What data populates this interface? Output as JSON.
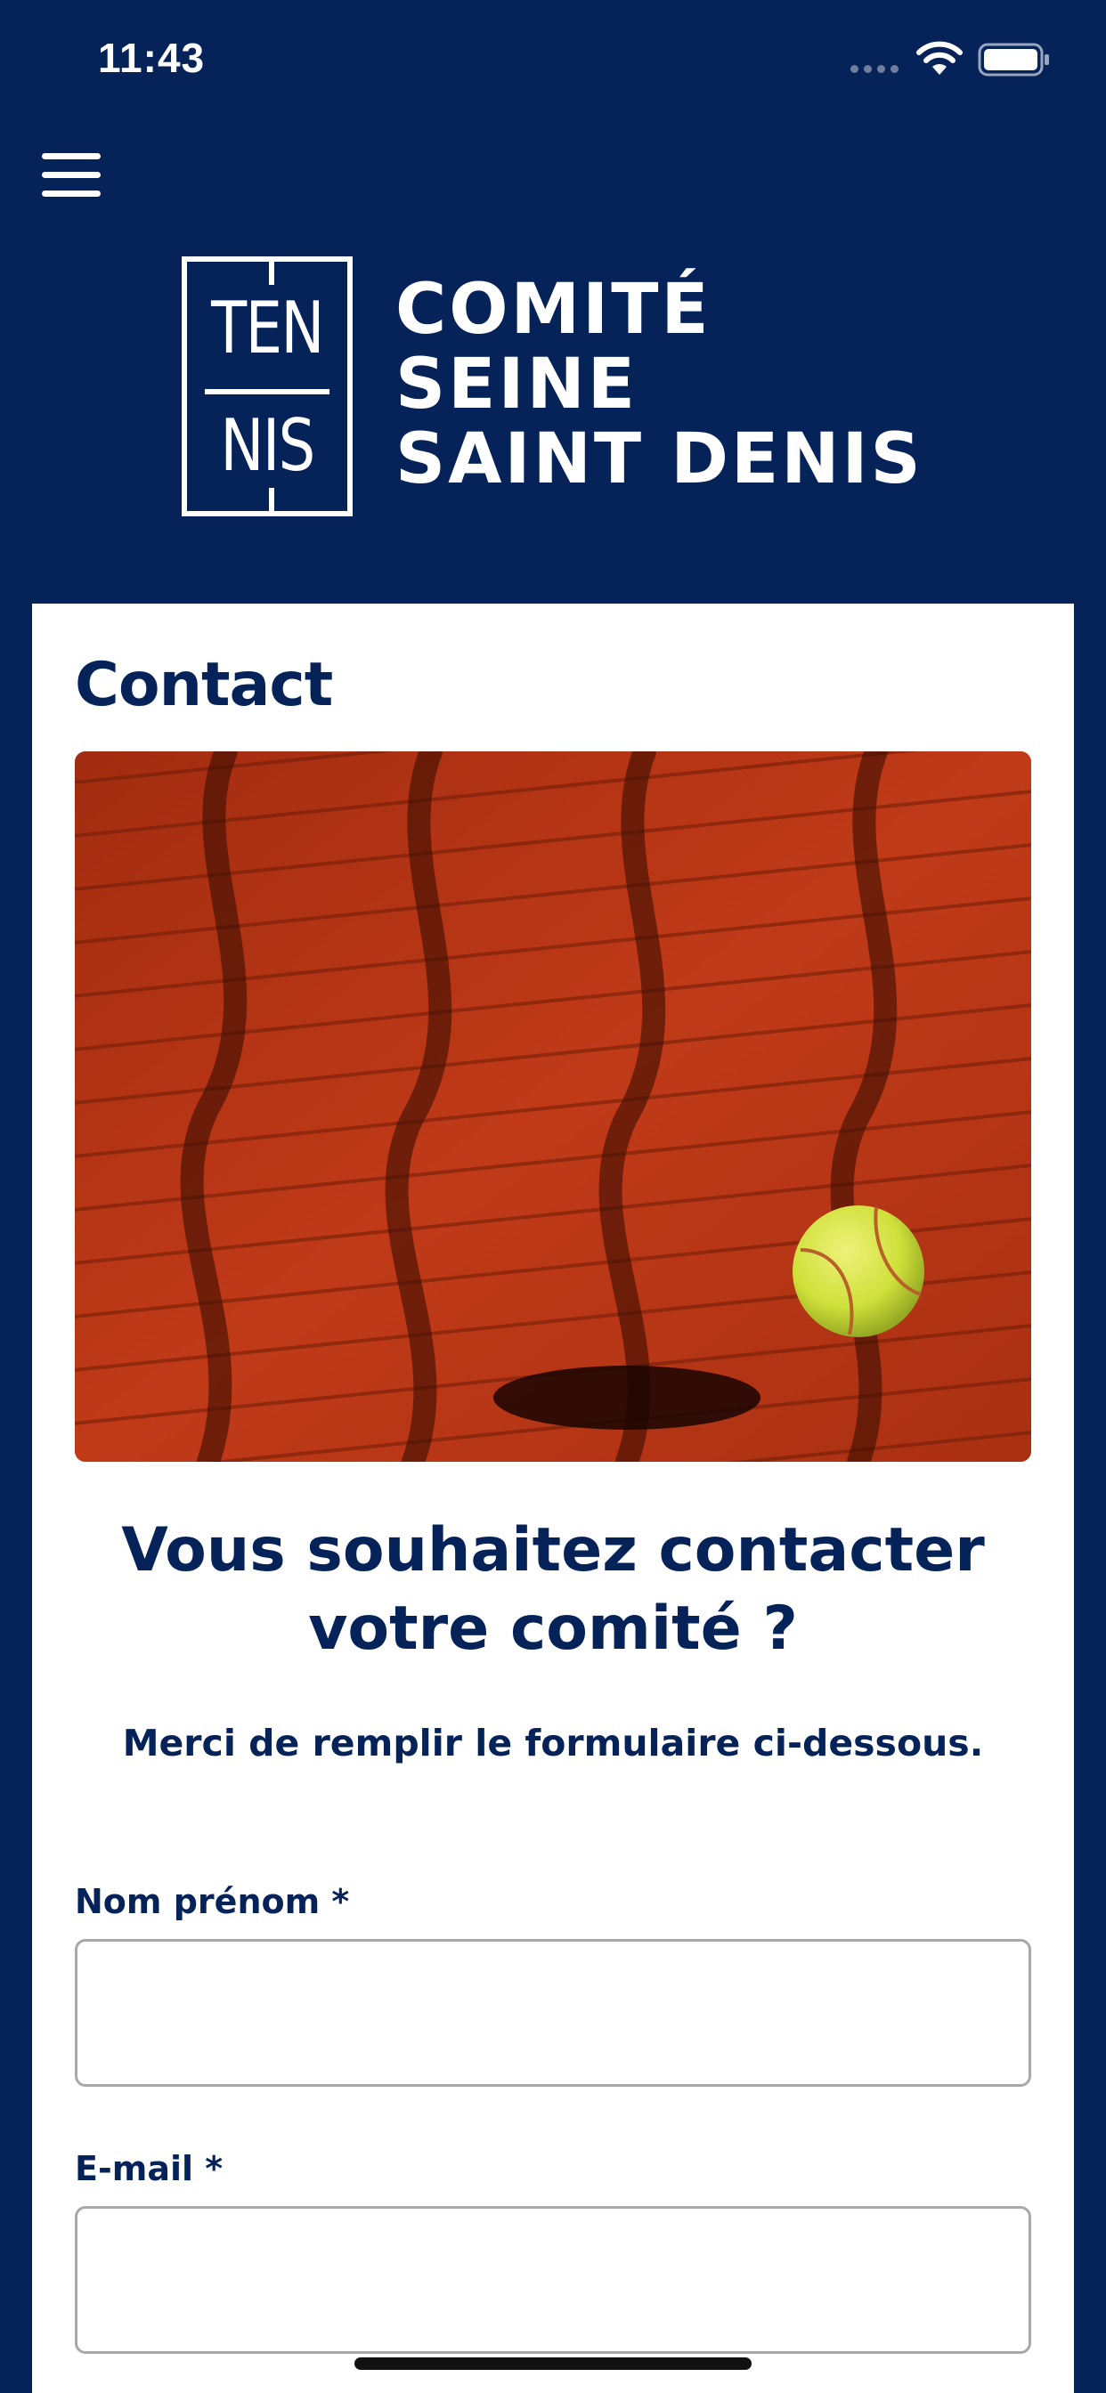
{
  "status_bar": {
    "time": "11:43"
  },
  "header": {
    "logo_box_top": "TEN",
    "logo_box_bottom": "NIS",
    "logo_lines": [
      "COMITÉ",
      "SEINE",
      "SAINT DENIS"
    ]
  },
  "page": {
    "title": "Contact",
    "headline": "Vous souhaitez contacter votre comité ?",
    "subtext": "Merci de remplir le formulaire ci-dessous."
  },
  "form": {
    "name_label": "Nom prénom *",
    "name_value": "",
    "email_label": "E-mail *",
    "email_value": ""
  },
  "colors": {
    "brand_navy": "#052259",
    "clay": "#b63516",
    "ball": "#d8e83a"
  },
  "icons": {
    "menu": "hamburger-menu-icon",
    "wifi": "wifi-icon",
    "battery": "battery-icon",
    "signal": "signal-icon"
  }
}
